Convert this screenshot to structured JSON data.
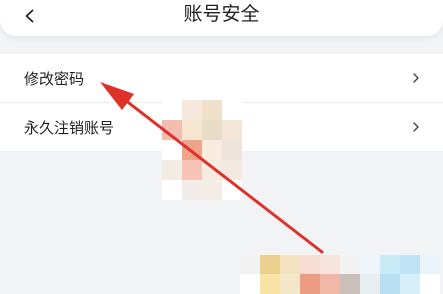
{
  "header": {
    "title": "账号安全",
    "back_icon": "chevron-left-icon"
  },
  "menu": {
    "items": [
      {
        "label": "修改密码",
        "chevron_icon": "chevron-right-icon"
      },
      {
        "label": "永久注销账号",
        "chevron_icon": "chevron-right-icon"
      }
    ]
  },
  "colors": {
    "background": "#f2f3f5",
    "surface": "#ffffff",
    "text": "#222222",
    "annotation_arrow": "#e0302a"
  }
}
